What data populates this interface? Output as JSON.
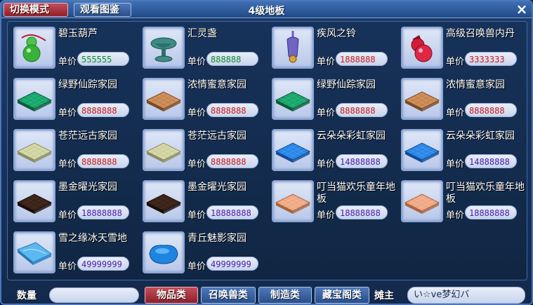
{
  "window": {
    "title": "4级地板",
    "switch_mode_label": "切换模式",
    "view_catalog_label": "观看图鉴",
    "close_label": "×"
  },
  "items": [
    {
      "name": "碧玉葫芦",
      "price_label": "单价",
      "price": "555555",
      "color": "green",
      "icon": "gourd-icon"
    },
    {
      "name": "汇灵盏",
      "price_label": "单价",
      "price": "888888",
      "color": "green",
      "icon": "lamp-icon"
    },
    {
      "name": "疾风之铃",
      "price_label": "单价",
      "price": "1888888",
      "color": "red",
      "icon": "bell-icon"
    },
    {
      "name": "高级召唤兽内丹",
      "price_label": "单价",
      "price": "3333333",
      "color": "red",
      "icon": "pearl-icon"
    },
    {
      "name": "绿野仙踪家园",
      "price_label": "单价",
      "price": "8888888",
      "color": "red",
      "icon": "green-floor-icon"
    },
    {
      "name": "浓情蜜意家园",
      "price_label": "单价",
      "price": "8888888",
      "color": "red",
      "icon": "brown-floor-icon"
    },
    {
      "name": "绿野仙踪家园",
      "price_label": "单价",
      "price": "8888888",
      "color": "red",
      "icon": "green-floor-icon"
    },
    {
      "name": "浓情蜜意家园",
      "price_label": "单价",
      "price": "8888888",
      "color": "red",
      "icon": "brown-floor-icon"
    },
    {
      "name": "苍茫远古家园",
      "price_label": "单价",
      "price": "8888888",
      "color": "red",
      "icon": "beige-floor-icon"
    },
    {
      "name": "苍茫远古家园",
      "price_label": "单价",
      "price": "8888888",
      "color": "red",
      "icon": "beige-floor-icon"
    },
    {
      "name": "云朵朵彩虹家园",
      "price_label": "单价",
      "price": "14888888",
      "color": "purple",
      "icon": "blue-floor-icon"
    },
    {
      "name": "云朵朵彩虹家园",
      "price_label": "单价",
      "price": "14888888",
      "color": "purple",
      "icon": "blue-floor-icon"
    },
    {
      "name": "墨金曜光家园",
      "price_label": "单价",
      "price": "18888888",
      "color": "purple",
      "icon": "black-floor-icon"
    },
    {
      "name": "墨金曜光家园",
      "price_label": "单价",
      "price": "18888888",
      "color": "purple",
      "icon": "black-floor-icon"
    },
    {
      "name": "叮当猫欢乐童年地板",
      "price_label": "单价",
      "price": "18888888",
      "color": "purple",
      "icon": "peach-floor-icon"
    },
    {
      "name": "叮当猫欢乐童年地板",
      "price_label": "单价",
      "price": "18888888",
      "color": "purple",
      "icon": "peach-floor-icon"
    },
    {
      "name": "雪之缘冰天雪地",
      "price_label": "单价",
      "price": "49999999",
      "color": "purple",
      "icon": "ice-floor-icon"
    },
    {
      "name": "青丘魅影家园",
      "price_label": "单价",
      "price": "49999999",
      "color": "purple",
      "icon": "blue-blob-icon"
    }
  ],
  "bottom": {
    "qty_label": "数量",
    "qty_value": "",
    "categories": [
      "物品类",
      "召唤兽类",
      "制造类",
      "藏宝阁类"
    ],
    "active_category": "物品类",
    "owner_label": "摊主",
    "owner_name": "い☆ve梦幻バ"
  },
  "colors": {
    "green_price": "#0a8a2e",
    "red_price": "#cc1b1b",
    "purple_price": "#4a1ea8",
    "active_tab": "#8e1f2a",
    "tab": "#2a4e89"
  }
}
